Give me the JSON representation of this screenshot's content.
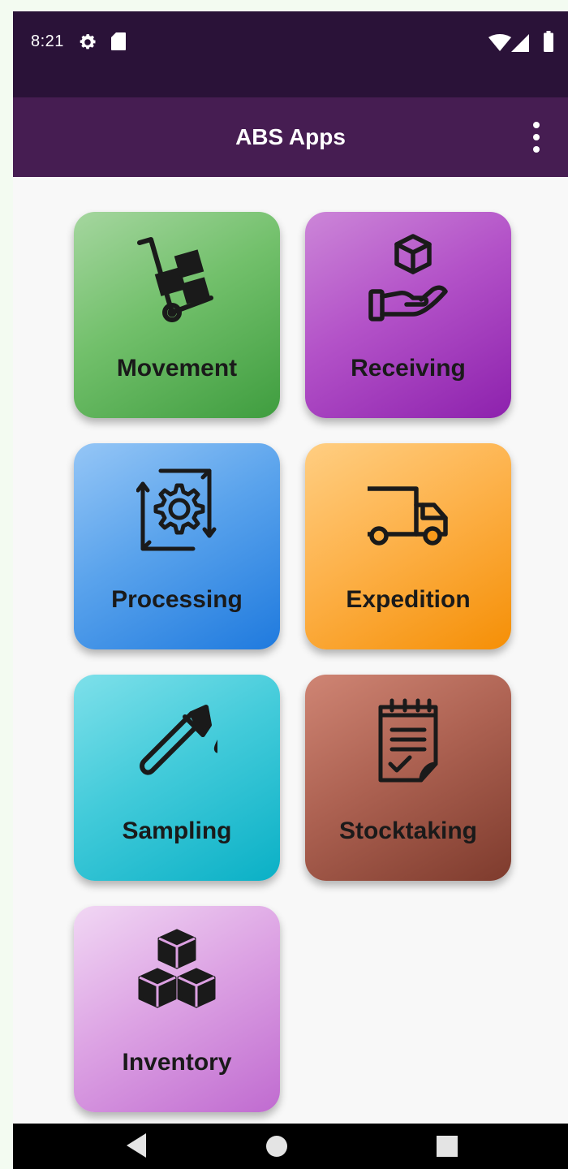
{
  "status_bar": {
    "time": "8:21",
    "icons": [
      "settings-icon",
      "sdcard-icon",
      "wifi-icon",
      "signal-icon",
      "battery-icon"
    ]
  },
  "app_bar": {
    "title": "ABS Apps",
    "menu_icon": "more-vert-icon"
  },
  "tiles": [
    {
      "label": "Movement",
      "icon": "hand-truck-icon",
      "color": "#5fb55a"
    },
    {
      "label": "Receiving",
      "icon": "box-in-hand-icon",
      "color": "#a93fc0"
    },
    {
      "label": "Processing",
      "icon": "gear-cycle-icon",
      "color": "#3e8fe6"
    },
    {
      "label": "Expedition",
      "icon": "truck-icon",
      "color": "#fba530"
    },
    {
      "label": "Sampling",
      "icon": "test-tube-icon",
      "color": "#2dbfd1"
    },
    {
      "label": "Stocktaking",
      "icon": "checklist-notepad-icon",
      "color": "#9a5243"
    },
    {
      "label": "Inventory",
      "icon": "stacked-boxes-icon",
      "color": "#d08bdb"
    }
  ],
  "nav_bar": {
    "icons": [
      "back-icon",
      "home-icon",
      "recents-icon"
    ]
  }
}
